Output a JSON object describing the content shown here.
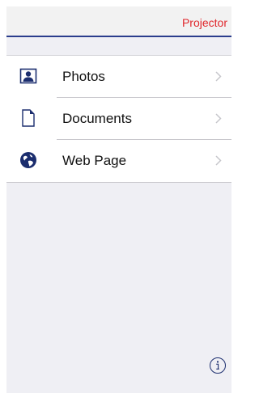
{
  "nav": {
    "right_label": "Projector",
    "accent_color": "#2b3d8c",
    "action_color": "#e0262b"
  },
  "menu": {
    "items": [
      {
        "label": "Photos",
        "icon": "photo-contact-icon"
      },
      {
        "label": "Documents",
        "icon": "document-icon"
      },
      {
        "label": "Web Page",
        "icon": "globe-icon"
      }
    ]
  },
  "footer": {
    "info_icon": "info-icon"
  }
}
